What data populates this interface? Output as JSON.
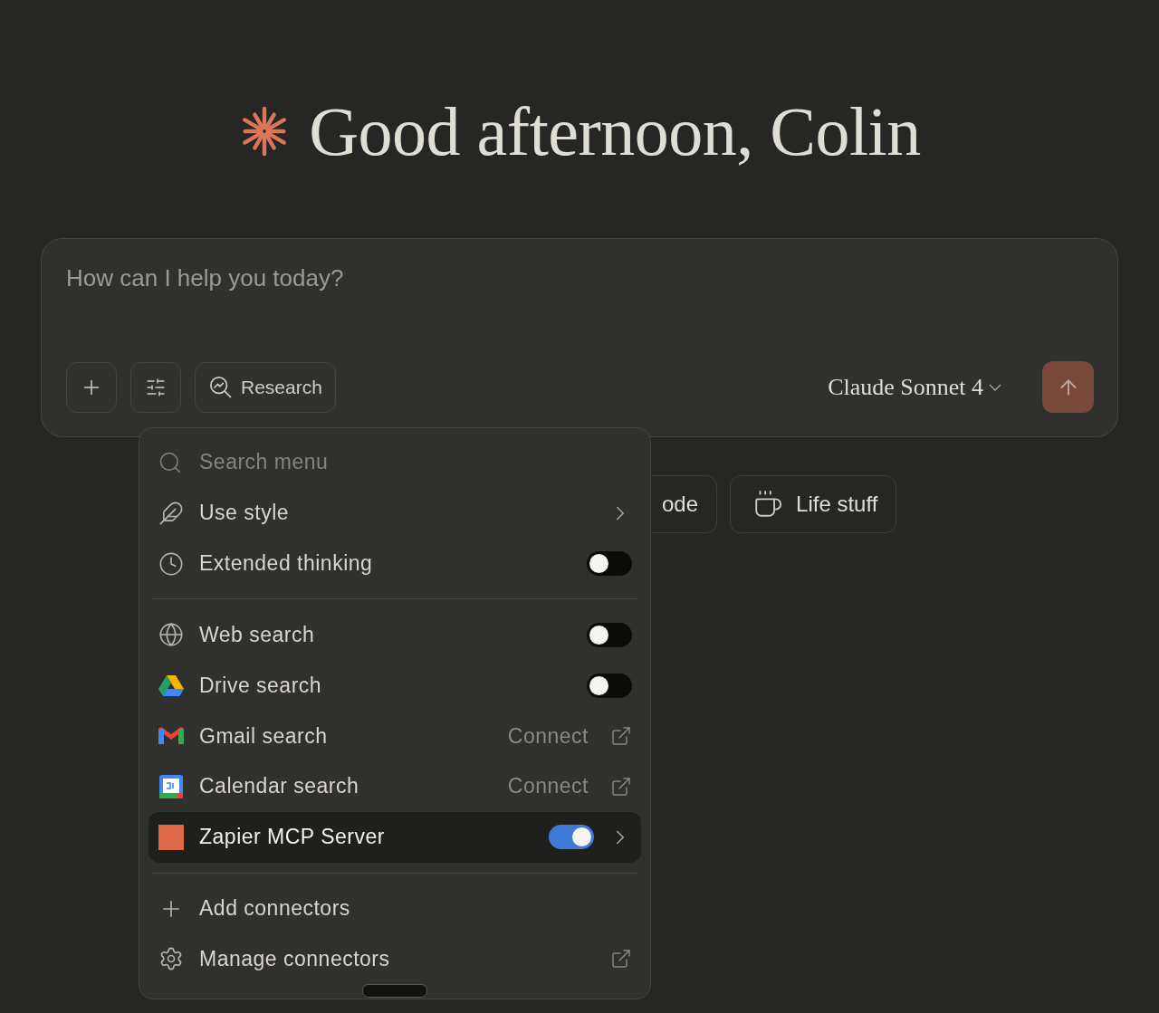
{
  "greeting": "Good afternoon, Colin",
  "composer": {
    "placeholder": "How can I help you today?",
    "research_label": "Research",
    "model": "Claude Sonnet 4"
  },
  "chips": [
    {
      "label": "ode"
    },
    {
      "label": "Life stuff"
    }
  ],
  "menu": {
    "search_placeholder": "Search menu",
    "sections": [
      [
        {
          "kind": "submenu",
          "label": "Use style"
        },
        {
          "kind": "toggle",
          "label": "Extended thinking",
          "on": false,
          "selected": false
        }
      ],
      [
        {
          "kind": "toggle",
          "label": "Web search",
          "on": false,
          "selected": false
        },
        {
          "kind": "toggle",
          "label": "Drive search",
          "on": false,
          "selected": false
        },
        {
          "kind": "connect",
          "label": "Gmail search",
          "action": "Connect"
        },
        {
          "kind": "connect",
          "label": "Calendar search",
          "action": "Connect"
        },
        {
          "kind": "toggle",
          "label": "Zapier MCP Server",
          "on": true,
          "selected": true,
          "submenu": true
        }
      ],
      [
        {
          "kind": "action",
          "label": "Add connectors"
        },
        {
          "kind": "external",
          "label": "Manage connectors"
        }
      ]
    ]
  }
}
